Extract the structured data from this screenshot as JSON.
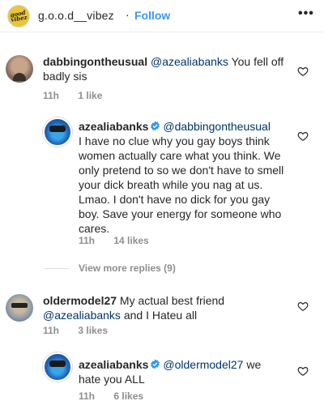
{
  "header": {
    "avatar_text": "good vibez",
    "username": "g.o.o.d__vibez",
    "separator": "·",
    "follow_label": "Follow",
    "more_label": "•••"
  },
  "comments": [
    {
      "username": "dabbingontheusual",
      "mention": "@azealiabanks",
      "text_lines": [
        "You fell off",
        "badly sis"
      ],
      "time": "11h",
      "likes": "1 like"
    },
    {
      "username": "azealiabanks",
      "verified": true,
      "mention": "@dabbingontheusual",
      "text_lines": [
        "I have no clue why you gay boys think",
        "women actually care what you think. We",
        "only pretend to so we don't have to smell",
        "your dick breath while you nag at us.",
        "Lmao. I don't have no dick for you gay",
        "boy. Save your energy for someone who",
        "cares."
      ],
      "time": "11h",
      "likes": "14 likes"
    },
    {
      "username": "oldermodel27",
      "mention": "@azealiabanks",
      "text_lines": [
        "My actual best friend",
        "and I Hateu all"
      ],
      "time": "11h",
      "likes": "3 likes"
    },
    {
      "username": "azealiabanks",
      "verified": true,
      "mention": "@oldermodel27",
      "text_lines": [
        "we",
        "hate you ALL"
      ],
      "time": "11h",
      "likes": "6 likes"
    }
  ],
  "view_more_label": "View more replies (9)",
  "colors": {
    "link_blue": "#3897f0",
    "mention": "#003569",
    "meta_gray": "#8e8e8e",
    "verified_blue": "#3897f0"
  }
}
